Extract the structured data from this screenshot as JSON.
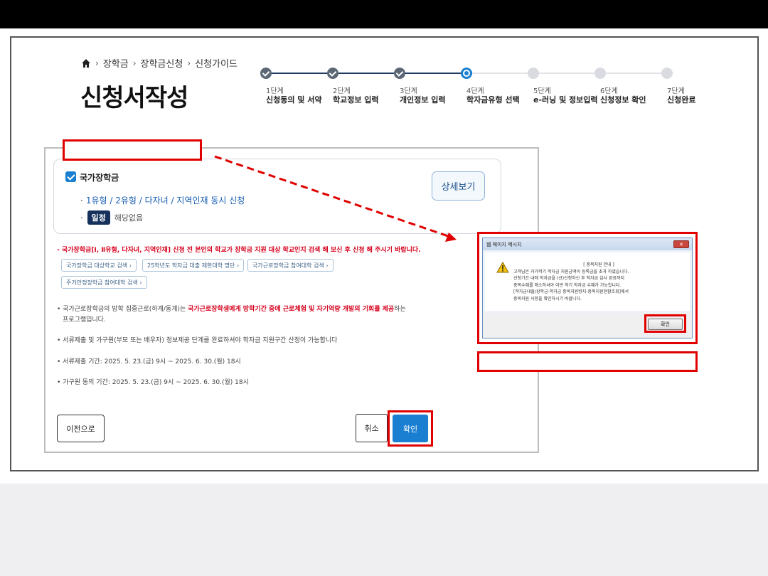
{
  "breadcrumb": {
    "items": [
      "장학금",
      "장학금신청",
      "신청가이드"
    ]
  },
  "page_title": "신청서작성",
  "steps": [
    {
      "num": "1단계",
      "name": "신청동의 및 서약",
      "state": "done"
    },
    {
      "num": "2단계",
      "name": "학교정보 입력",
      "state": "done"
    },
    {
      "num": "3단계",
      "name": "개인정보 입력",
      "state": "done"
    },
    {
      "num": "4단계",
      "name": "학자금유형 선택",
      "state": "current"
    },
    {
      "num": "5단계",
      "name": "e-러닝 및 정보입력",
      "state": "todo"
    },
    {
      "num": "6단계",
      "name": "신청정보 확인",
      "state": "todo"
    },
    {
      "num": "7단계",
      "name": "신청완료",
      "state": "todo"
    }
  ],
  "scholarship_card": {
    "title": "국가장학금",
    "types": "1유형 / 2유형 / 다자녀 / 지역인재 동시 신청",
    "status_badge": "일정",
    "status_text": "해당없음",
    "detail_button": "상세보기"
  },
  "notice_red": "- 국가장학금[Ⅰ, Ⅱ유형, 다자녀, 지역인재] 신청 전 본인의 학교가 장학금 지원 대상 학교인지 검색 해 보신 후 신청 해 주시기 바랍니다.",
  "link_buttons": [
    "국가장학금 대상학교 검색",
    "25학년도 학자금 대출 제한대학 명단",
    "국가근로장학금 참여대학 검색",
    "주거안정장학금 참여대학 검색"
  ],
  "info": {
    "line1_prefix": "• 국가근로장학금의 방학 집중근로(하계/동계)는 ",
    "line1_highlight": "국가근로장학생에게 방학기간 중에 근로체험 및 자기역량 개발의 기회를 제공",
    "line1_suffix": "하는",
    "line1_cont": "프로그램입니다.",
    "line2": "• 서류제출 및 가구원(부모 또는 배우자) 정보제공 단계를 완료하셔야 학자금 지원구간 산정이 가능합니다",
    "line3": "• 서류제출 기간: 2025. 5. 23.(금) 9시 ~ 2025. 6. 30.(월) 18시",
    "line4": "• 가구원 동의 기간: 2025. 5. 23.(금) 9시 ~ 2025. 6. 30.(월) 18시"
  },
  "buttons": {
    "prev": "이전으로",
    "cancel": "취소",
    "confirm": "확인"
  },
  "dialog": {
    "title": "웹 페이지 메시지",
    "close": "✕",
    "heading": "[ 중복지원 안내 ]",
    "lines": [
      "고객님은 과거학기 학자금 지원금액이 등록금을 초과 하였습니다.",
      "신청기간 내에 학자금을 (선)신청하신 후 학자금 심사 완료까지",
      "중복수혜를 해소하셔야 이번 학기 학자금 수혜가 가능합니다.",
      "[학자금대출/장학금-학자금 중복지원방지-중복지원현황조회]에서",
      "중복지원 사항을 확인하시기 바랍니다."
    ],
    "ok": "확인"
  },
  "colors": {
    "accent": "#1a7fd1",
    "annotation_red": "#e00000",
    "notice_red": "#d6001c",
    "badge_navy": "#16325c"
  }
}
